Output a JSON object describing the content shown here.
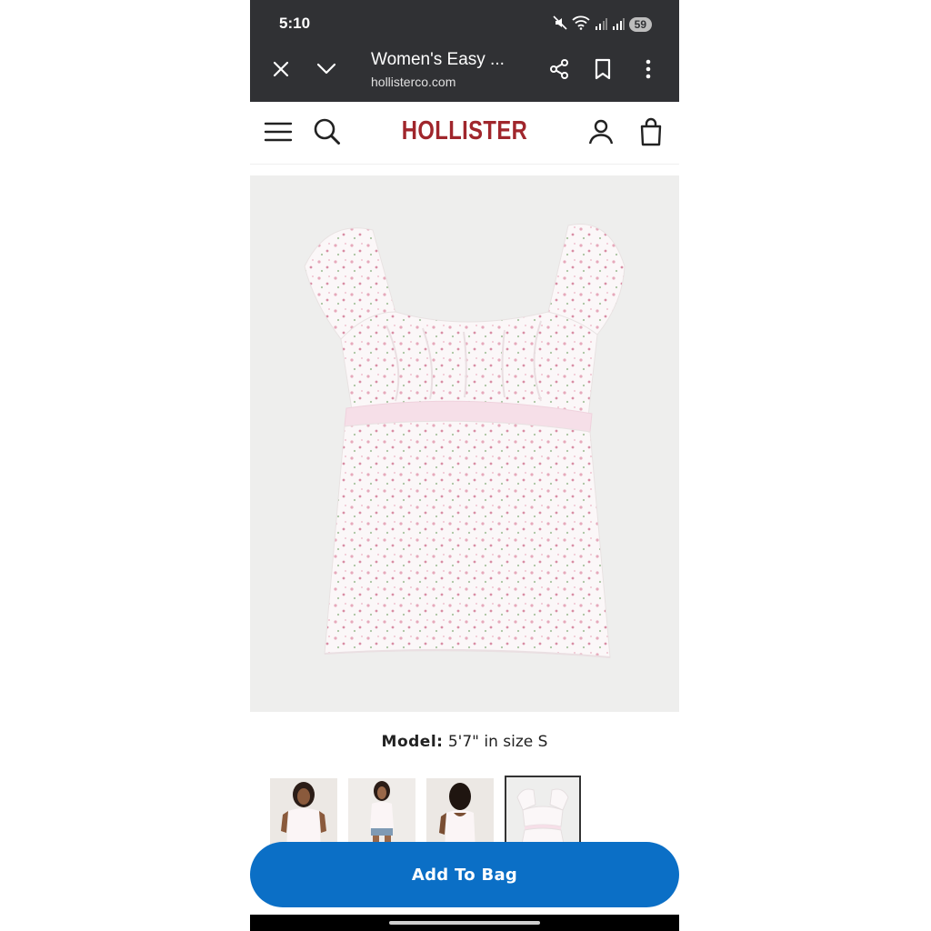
{
  "status_bar": {
    "time": "5:10",
    "battery": "59"
  },
  "browser": {
    "tab_title": "Women's Easy ...",
    "url": "hollisterco.com"
  },
  "site": {
    "logo": "HOLLISTER",
    "brand_color": "#a0262c"
  },
  "product": {
    "model_label": "Model:",
    "model_value": "5'7\" in size S",
    "thumbnail_count": 4,
    "selected_thumbnail": 4
  },
  "actions": {
    "add_to_bag": "Add To Bag",
    "accent": "#0b6fc6"
  }
}
